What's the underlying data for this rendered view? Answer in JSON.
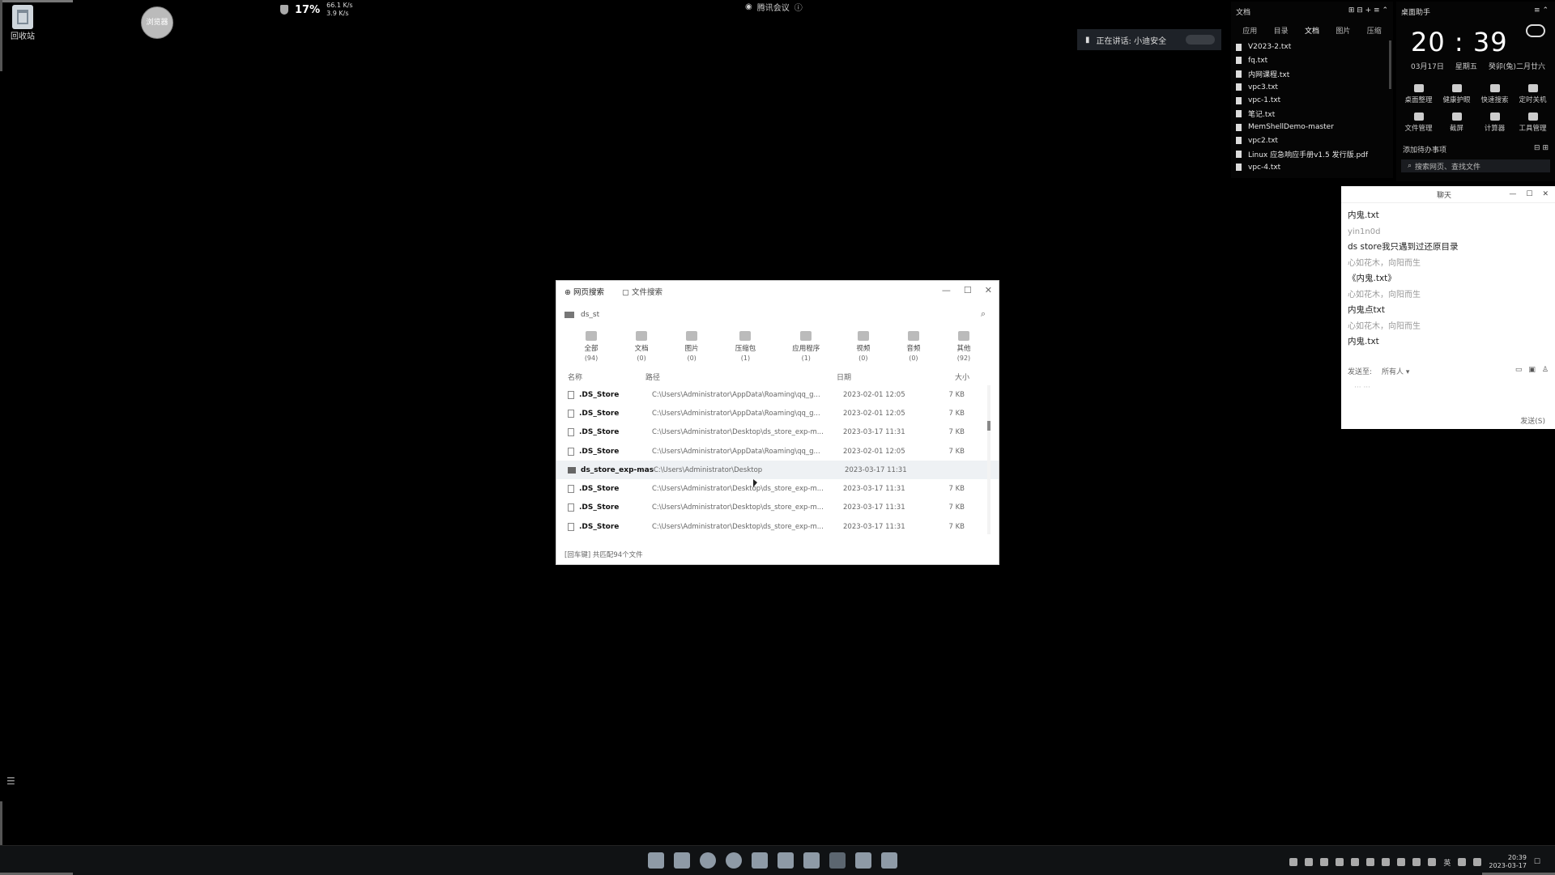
{
  "desktop": {
    "recycle_label": "回收站",
    "avatar_label": "浏览器"
  },
  "netmon": {
    "cpu_pct": "17%",
    "up": "66.1 K/s",
    "down": "3.9 K/s"
  },
  "meeting": {
    "label": "腾讯会议",
    "speaking": "正在讲话: 小迪安全"
  },
  "file_widget": {
    "title": "文档",
    "tabs": [
      "应用",
      "目录",
      "文档",
      "图片",
      "压缩"
    ],
    "files": [
      "V2023-2.txt",
      "fq.txt",
      "内网课程.txt",
      "vpc3.txt",
      "vpc-1.txt",
      "笔记.txt",
      "MemShellDemo-master",
      "vpc2.txt",
      "Linux 应急响应手册v1.5 发行版.pdf",
      "vpc-4.txt"
    ]
  },
  "assistant": {
    "title": "桌面助手",
    "time": "20 : 39",
    "date": "03月17日",
    "weekday": "星期五",
    "lunar": "癸卯(兔)二月廿六",
    "tools": [
      "桌面整理",
      "健康护眼",
      "快速搜索",
      "定时关机",
      "文件管理",
      "截屏",
      "计算器",
      "工具管理"
    ],
    "todo": "添加待办事项",
    "search_placeholder": "搜索网页、查找文件"
  },
  "chat": {
    "title": "聊天",
    "messages": [
      {
        "text": "内鬼.txt",
        "kind": "msg"
      },
      {
        "text": "yin1n0d",
        "kind": "user"
      },
      {
        "text": "ds store我只遇到过还原目录",
        "kind": "msg"
      },
      {
        "text": "心如花木，向阳而生",
        "kind": "user"
      },
      {
        "text": "《内鬼.txt》",
        "kind": "msg"
      },
      {
        "text": "心如花木，向阳而生",
        "kind": "user"
      },
      {
        "text": "内鬼点txt",
        "kind": "msg"
      },
      {
        "text": "心如花木，向阳而生",
        "kind": "user"
      },
      {
        "text": "内鬼.txt",
        "kind": "msg"
      }
    ],
    "send_to_label": "发送至:",
    "send_to_value": "所有人",
    "dots": "···    ···",
    "send_button": "发送(S)"
  },
  "search_window": {
    "tabs": [
      "网页搜索",
      "文件搜索"
    ],
    "query": "ds_st",
    "categories": [
      {
        "name": "全部",
        "count": "(94)"
      },
      {
        "name": "文档",
        "count": "(0)"
      },
      {
        "name": "图片",
        "count": "(0)"
      },
      {
        "name": "压缩包",
        "count": "(1)"
      },
      {
        "name": "应用程序",
        "count": "(1)"
      },
      {
        "name": "视频",
        "count": "(0)"
      },
      {
        "name": "音频",
        "count": "(0)"
      },
      {
        "name": "其他",
        "count": "(92)"
      }
    ],
    "columns": [
      "名称",
      "路径",
      "日期",
      "大小"
    ],
    "rows": [
      {
        "name": ".DS_Store",
        "path": "C:\\Users\\Administrator\\AppData\\Roaming\\qq_g...",
        "date": "2023-02-01 12:05",
        "size": "7 KB",
        "folder": false
      },
      {
        "name": ".DS_Store",
        "path": "C:\\Users\\Administrator\\AppData\\Roaming\\qq_g...",
        "date": "2023-02-01 12:05",
        "size": "7 KB",
        "folder": false
      },
      {
        "name": ".DS_Store",
        "path": "C:\\Users\\Administrator\\Desktop\\ds_store_exp-m...",
        "date": "2023-03-17 11:31",
        "size": "7 KB",
        "folder": false
      },
      {
        "name": ".DS_Store",
        "path": "C:\\Users\\Administrator\\AppData\\Roaming\\qq_g...",
        "date": "2023-02-01 12:05",
        "size": "7 KB",
        "folder": false
      },
      {
        "name": "ds_store_exp-mast",
        "path": "C:\\Users\\Administrator\\Desktop",
        "date": "2023-03-17 11:31",
        "size": "",
        "folder": true
      },
      {
        "name": ".DS_Store",
        "path": "C:\\Users\\Administrator\\Desktop\\ds_store_exp-m...",
        "date": "2023-03-17 11:31",
        "size": "7 KB",
        "folder": false
      },
      {
        "name": ".DS_Store",
        "path": "C:\\Users\\Administrator\\Desktop\\ds_store_exp-m...",
        "date": "2023-03-17 11:31",
        "size": "7 KB",
        "folder": false
      },
      {
        "name": ".DS_Store",
        "path": "C:\\Users\\Administrator\\Desktop\\ds_store_exp-m...",
        "date": "2023-03-17 11:31",
        "size": "7 KB",
        "folder": false
      }
    ],
    "status": "[回车键] 共匹配94个文件"
  },
  "taskbar": {
    "time": "20:39",
    "date": "2023-03-17"
  }
}
